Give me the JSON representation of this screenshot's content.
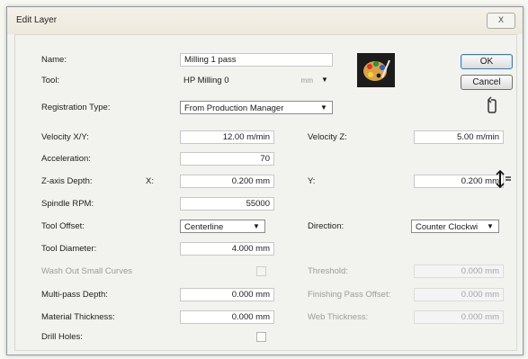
{
  "window": {
    "title": "Edit Layer",
    "close_label": "X"
  },
  "buttons": {
    "ok": "OK",
    "cancel": "Cancel"
  },
  "icons": {
    "palette": "palette-icon",
    "rotate": "rotate-arrow-icon",
    "pointer": "cursor-icon"
  },
  "fields": {
    "name": {
      "label": "Name:",
      "value": "Milling 1 pass"
    },
    "tool": {
      "label": "Tool:",
      "value": "HP Milling 0",
      "unit": "mm"
    },
    "registration_type": {
      "label": "Registration Type:",
      "value": "From Production Manager"
    },
    "velocity_xy": {
      "label": "Velocity X/Y:",
      "value": "12.00 m/min"
    },
    "velocity_z": {
      "label": "Velocity Z:",
      "value": "5.00 m/min"
    },
    "acceleration": {
      "label": "Acceleration:",
      "value": "70"
    },
    "z_axis_depth": {
      "label": "Z-axis Depth:",
      "x_label": "X:",
      "x_value": "0.200 mm",
      "y_label": "Y:",
      "y_value": "0.200 mm"
    },
    "spindle_rpm": {
      "label": "Spindle RPM:",
      "value": "55000"
    },
    "tool_offset": {
      "label": "Tool Offset:",
      "value": "Centerline"
    },
    "direction": {
      "label": "Direction:",
      "value": "Counter Clockwi"
    },
    "tool_diameter": {
      "label": "Tool Diameter:",
      "value": "4.000 mm"
    },
    "wash_out": {
      "label": "Wash Out Small Curves"
    },
    "threshold": {
      "label": "Threshold:",
      "value": "0.000 mm"
    },
    "multipass_depth": {
      "label": "Multi-pass Depth:",
      "value": "0.000 mm"
    },
    "finishing_pass_offset": {
      "label": "Finishing Pass Offset:",
      "value": "0.000 mm"
    },
    "material_thickness": {
      "label": "Material Thickness:",
      "value": "0.000 mm"
    },
    "web_thickness": {
      "label": "Web Thickness:",
      "value": "0.000 mm"
    },
    "drill_holes": {
      "label": "Drill Holes:"
    }
  }
}
